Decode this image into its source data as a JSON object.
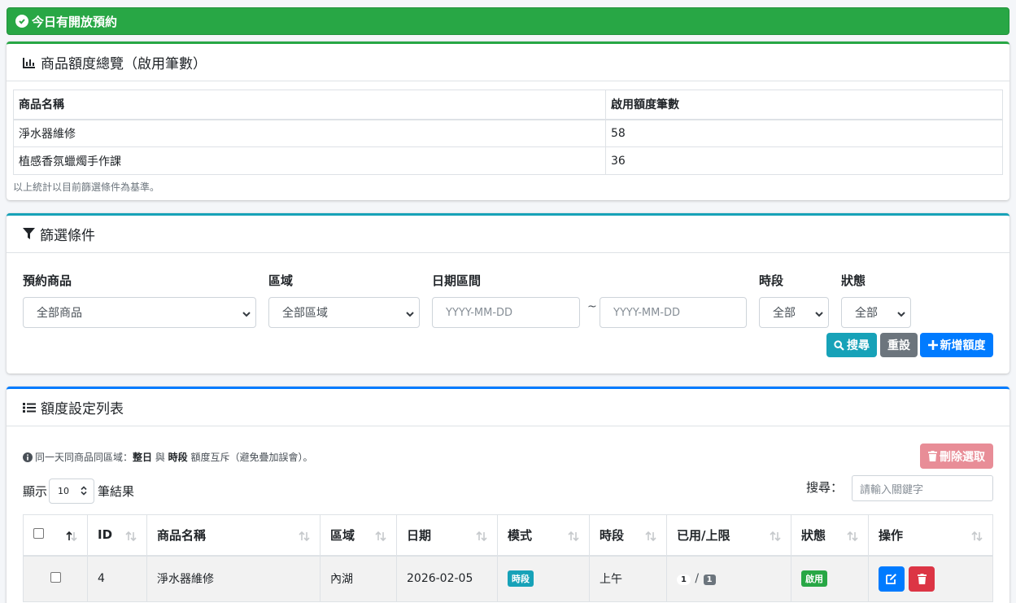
{
  "alert": {
    "text": "今日有開放預約"
  },
  "summary": {
    "title": "商品額度總覽（啟用筆數）",
    "headers": [
      "商品名稱",
      "啟用額度筆數"
    ],
    "rows": [
      [
        "淨水器維修",
        "58"
      ],
      [
        "植感香氛蠟燭手作課",
        "36"
      ]
    ],
    "note": "以上統計以目前篩選條件為基準。"
  },
  "filter": {
    "title": "篩選條件",
    "product_label": "預約商品",
    "product_value": "全部商品",
    "area_label": "區域",
    "area_value": "全部區域",
    "date_label": "日期區間",
    "date_from_placeholder": "YYYY-MM-DD",
    "date_to_placeholder": "YYYY-MM-DD",
    "date_sep": "~",
    "period_label": "時段",
    "period_value": "全部",
    "status_label": "狀態",
    "status_value": "全部",
    "search_btn": "搜尋",
    "reset_btn": "重設",
    "add_btn": "新增額度"
  },
  "list": {
    "title": "額度設定列表",
    "hint_prefix": "同一天同商品同區域：",
    "hint_b1": "整日",
    "hint_mid": " 與 ",
    "hint_b2": "時段",
    "hint_suffix": " 額度互斥（避免疊加誤會）。",
    "bulk_delete": "刪除選取",
    "show_prefix": "顯示",
    "page_length": "10",
    "show_suffix": "筆結果",
    "search_label": "搜尋：",
    "search_placeholder": "請輸入關鍵字",
    "columns": [
      "ID",
      "商品名稱",
      "區域",
      "日期",
      "模式",
      "時段",
      "已用/上限",
      "狀態",
      "操作"
    ],
    "rows": [
      {
        "id": "4",
        "product": "淨水器維修",
        "area": "內湖",
        "date": "2026-02-05",
        "mode": "時段",
        "period": "上午",
        "used": "1",
        "sep": "/",
        "limit": "1",
        "status": "啟用"
      }
    ]
  },
  "colors": {
    "success": "#28a745",
    "info": "#17a2b8",
    "primary": "#007bff",
    "danger": "#dc3545",
    "secondary": "#6c757d"
  },
  "icons": [
    "check-circle-icon",
    "bar-chart-icon",
    "filter-icon",
    "list-icon",
    "info-icon",
    "search-icon",
    "plus-icon",
    "trash-icon",
    "edit-icon",
    "sort-icon"
  ]
}
